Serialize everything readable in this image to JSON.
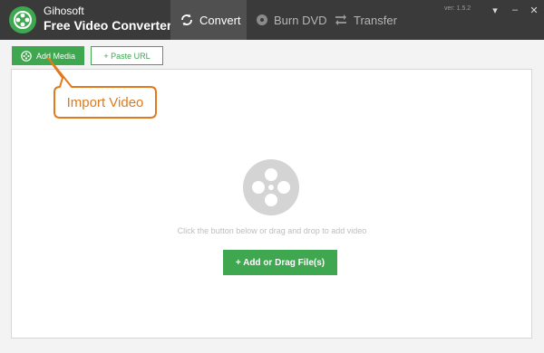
{
  "app": {
    "brand_line1": "Gihosoft",
    "brand_line2": "Free Video Converter",
    "version": "ver: 1.5.2"
  },
  "tabs": [
    {
      "label": "Convert",
      "icon": "refresh-icon",
      "active": true
    },
    {
      "label": "Burn DVD",
      "icon": "disc-icon",
      "active": false
    },
    {
      "label": "Transfer",
      "icon": "transfer-arrows-icon",
      "active": false
    }
  ],
  "window_controls": {
    "menu": "▾",
    "minimize": "–",
    "close": "✕"
  },
  "toolbar": {
    "add_media_label": "Add Media",
    "paste_url_label": "+ Paste URL"
  },
  "main": {
    "hint": "Click the button below or drag and drop to add video",
    "add_button_label": "+ Add or Drag File(s)"
  },
  "callout": {
    "text": "Import Video"
  },
  "colors": {
    "accent_green": "#3ea74f",
    "titlebar": "#3a3a3a",
    "active_tab": "#505050",
    "callout_orange": "#e07a1d"
  }
}
